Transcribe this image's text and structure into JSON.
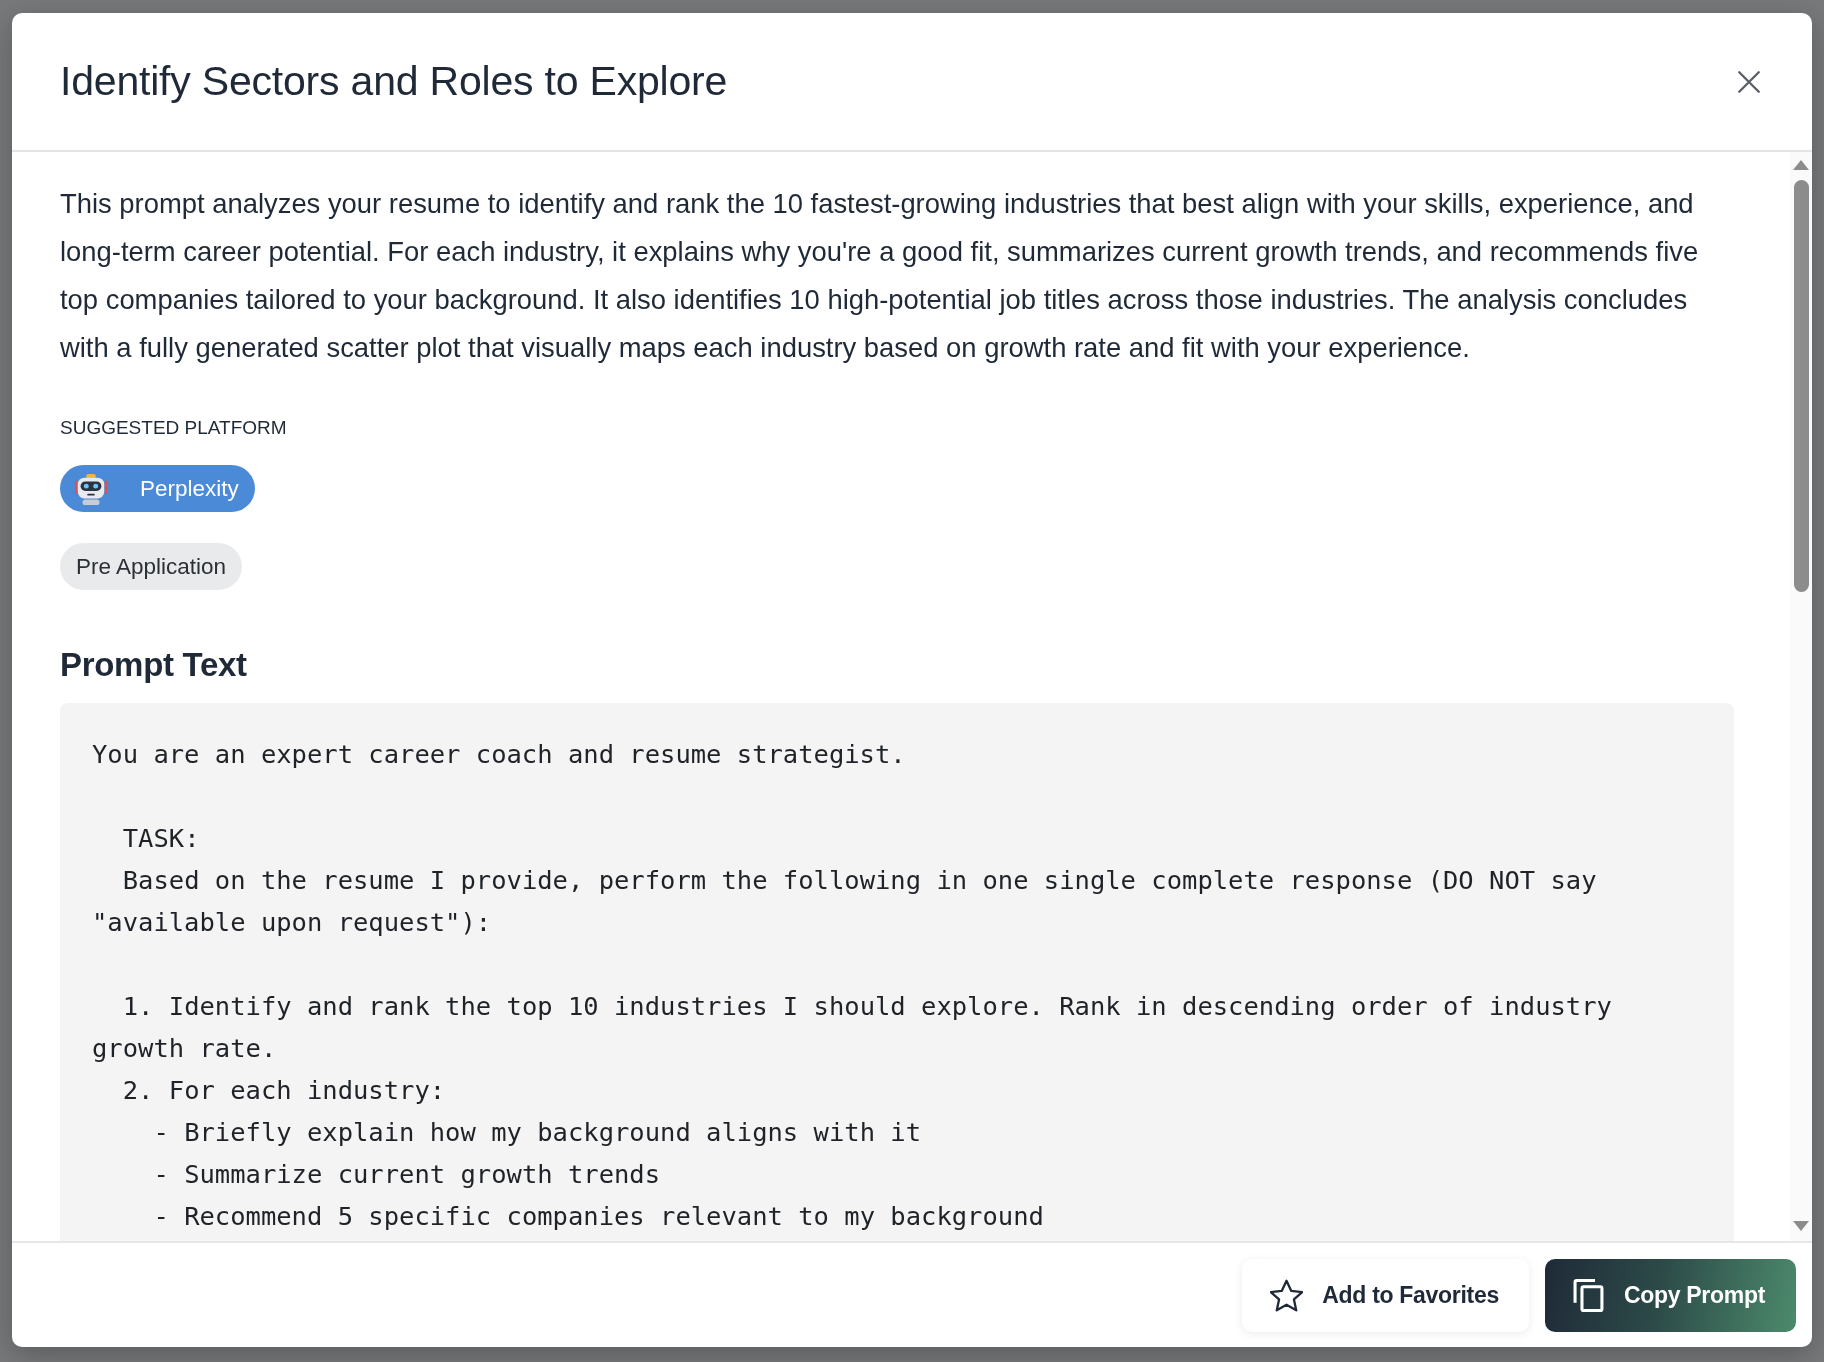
{
  "modal": {
    "title": "Identify Sectors and Roles to Explore"
  },
  "description": "This prompt analyzes your resume to identify and rank the 10 fastest-growing industries that best align with your skills, experience, and long-term career potential. For each industry, it explains why you're a good fit, summarizes current growth trends, and recommends five top companies tailored to your background. It also identifies 10 high-potential job titles across those industries. The analysis concludes with a fully generated scatter plot that visually maps each industry based on growth rate and fit with your experience.",
  "suggested_platform": {
    "label": "SUGGESTED PLATFORM",
    "platform": "Perplexity"
  },
  "tags": [
    "Pre Application"
  ],
  "prompt_section": {
    "heading": "Prompt Text",
    "text": "You are an expert career coach and resume strategist.\n\n  TASK:\n  Based on the resume I provide, perform the following in one single complete response (DO NOT say \"available upon request\"):\n\n  1. Identify and rank the top 10 industries I should explore. Rank in descending order of industry growth rate.\n  2. For each industry:\n    - Briefly explain how my background aligns with it\n    - Summarize current growth trends\n    - Recommend 5 specific companies relevant to my background"
  },
  "buttons": [
    {
      "kind": "secondary",
      "label": "Add to Favorites"
    },
    {
      "kind": "primary",
      "label": "Copy Prompt"
    }
  ]
}
